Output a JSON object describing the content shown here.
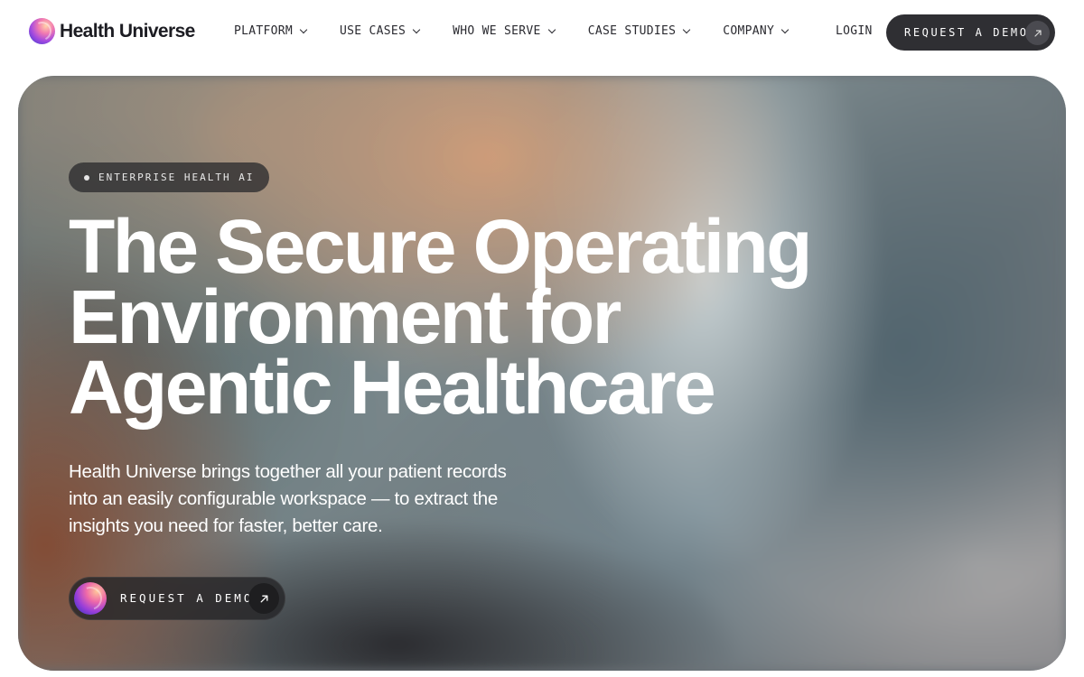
{
  "brand": {
    "name": "Health Universe",
    "logo_icon": "health-universe-orb-logo"
  },
  "nav": {
    "items": [
      {
        "label": "PLATFORM",
        "icon": "chevron-down-icon"
      },
      {
        "label": "USE CASES",
        "icon": "chevron-down-icon"
      },
      {
        "label": "WHO WE SERVE",
        "icon": "chevron-down-icon"
      },
      {
        "label": "CASE STUDIES",
        "icon": "chevron-down-icon"
      },
      {
        "label": "COMPANY",
        "icon": "chevron-down-icon"
      }
    ],
    "login_label": "LOGIN",
    "demo_button": {
      "label": "REQUEST A DEMO",
      "icon": "arrow-up-right-icon"
    }
  },
  "hero": {
    "badge": "ENTERPRISE HEALTH AI",
    "headline_lines": [
      "The Secure Operating",
      "Environment for",
      "Agentic Healthcare"
    ],
    "subtext": "Health Universe brings together all your patient records into an easily configurable workspace — to extract the insights you need for faster, better care.",
    "cta": {
      "label": "REQUEST A DEMO",
      "icon": "arrow-up-right-icon"
    }
  },
  "colors": {
    "nav_button_bg": "#2f2f33",
    "text_dark": "#1c1c22",
    "hero_text": "#ffffff"
  }
}
